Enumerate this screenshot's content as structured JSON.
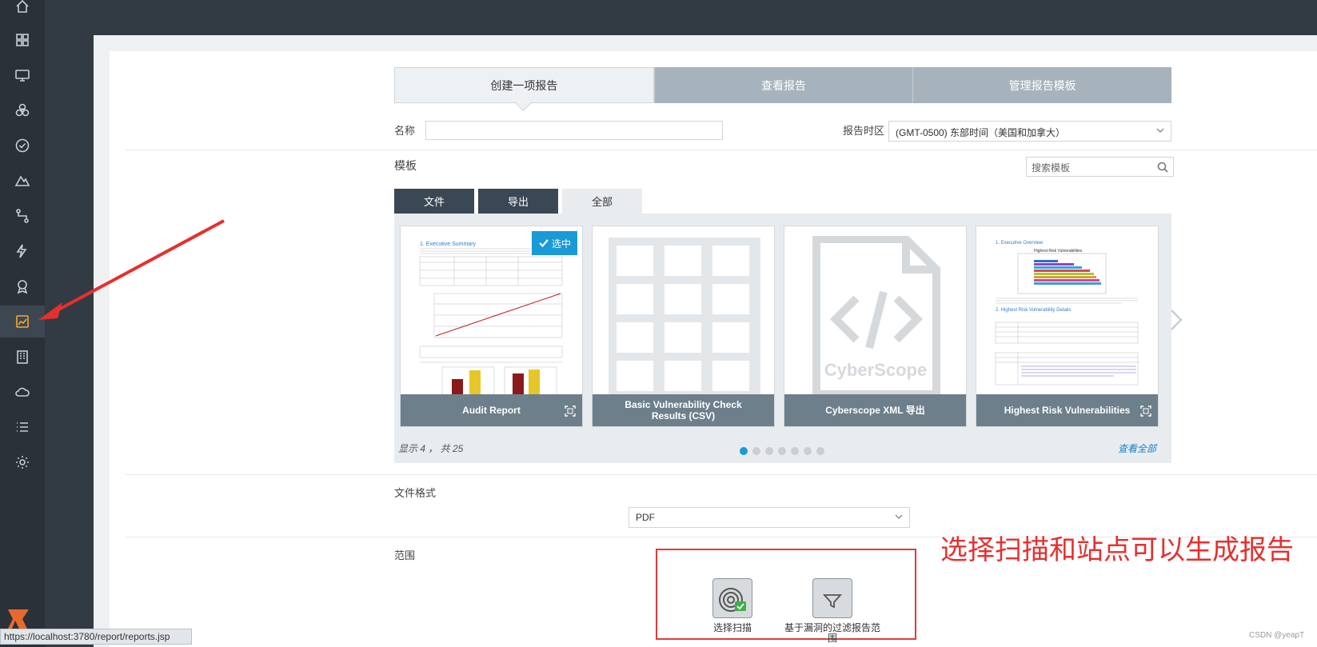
{
  "tabs": [
    "创建一项报告",
    "查看报告",
    "管理报告模板"
  ],
  "form": {
    "name_label": "名称",
    "name_value": "",
    "tz_label": "报告时区",
    "tz_value": "(GMT-0500) 东部时间（美国和加拿大）",
    "template_label": "模板",
    "search_placeholder": "搜索模板",
    "format_label": "文件格式",
    "format_value": "PDF",
    "scope_label": "范围"
  },
  "filter_tabs": [
    "文件",
    "导出",
    "全部"
  ],
  "templates": [
    {
      "caption": "Audit Report",
      "selected": true
    },
    {
      "caption": "Basic Vulnerability Check Results (CSV)",
      "selected": false
    },
    {
      "caption": "Cyberscope XML 导出",
      "selected": false
    },
    {
      "caption": "Highest Risk Vulnerabilities",
      "selected": false
    }
  ],
  "selected_badge": "选中",
  "thumb_text": {
    "audit_title": "1. Executive Summary",
    "highrisk_title": "1. Executive Overview",
    "highrisk_sub": "Highest Risk Vulnerabilities",
    "highrisk_sec2": "2. Highest Risk Vulnerability Details",
    "cyberscope_mark": "CyberScope"
  },
  "pager": {
    "showing": "显示 4 ， 共 25",
    "view_all": "查看全部",
    "dots": 7,
    "active": 0
  },
  "scope_buttons": [
    {
      "label": "选择扫描"
    },
    {
      "label": "基于漏洞的过滤报告范围"
    }
  ],
  "annotation": "选择扫描和站点可以生成报告",
  "status_url": "https://localhost:3780/report/reports.jsp",
  "watermark": "CSDN @yeapT",
  "colors": {
    "accent": "#1a9ad7",
    "annotation": "#e62f2f",
    "sidebar": "#2b3138",
    "active_icon": "#f3a73b"
  },
  "sidebar_icons": [
    "home-icon",
    "dashboard-icon",
    "assets-icon",
    "biohazard-icon",
    "check-icon",
    "mountain-icon",
    "route-icon",
    "lightning-icon",
    "award-icon",
    "reports-icon",
    "building-icon",
    "cloud-icon",
    "list-icon",
    "settings-icon"
  ]
}
